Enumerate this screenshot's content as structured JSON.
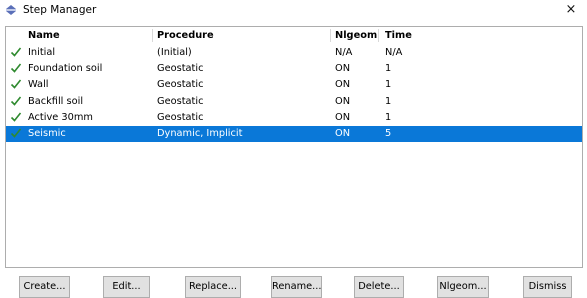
{
  "window": {
    "title": "Step Manager",
    "close_glyph": "×"
  },
  "table": {
    "columns": [
      "Name",
      "Procedure",
      "Nlgeom",
      "Time"
    ],
    "rows": [
      {
        "status_icon": "checkmark-icon",
        "name": "Initial",
        "procedure": "(Initial)",
        "nlgeom": "N/A",
        "time": "N/A",
        "selected": false
      },
      {
        "status_icon": "checkmark-icon",
        "name": "Foundation soil",
        "procedure": "Geostatic",
        "nlgeom": "ON",
        "time": "1",
        "selected": false
      },
      {
        "status_icon": "checkmark-icon",
        "name": "Wall",
        "procedure": "Geostatic",
        "nlgeom": "ON",
        "time": "1",
        "selected": false
      },
      {
        "status_icon": "checkmark-icon",
        "name": "Backfill soil",
        "procedure": "Geostatic",
        "nlgeom": "ON",
        "time": "1",
        "selected": false
      },
      {
        "status_icon": "checkmark-icon",
        "name": "Active 30mm",
        "procedure": "Geostatic",
        "nlgeom": "ON",
        "time": "1",
        "selected": false
      },
      {
        "status_icon": "checkmark-icon",
        "name": "Seismic",
        "procedure": "Dynamic, Implicit",
        "nlgeom": "ON",
        "time": "5",
        "selected": true
      }
    ]
  },
  "buttons": {
    "create": "Create...",
    "edit": "Edit...",
    "replace": "Replace...",
    "rename": "Rename...",
    "delete": "Delete...",
    "nlgeom": "Nlgeom...",
    "dismiss": "Dismiss"
  },
  "colors": {
    "selection": "#0a78d8",
    "check": "#2f8a2f",
    "button_face": "#e1e1e1"
  }
}
